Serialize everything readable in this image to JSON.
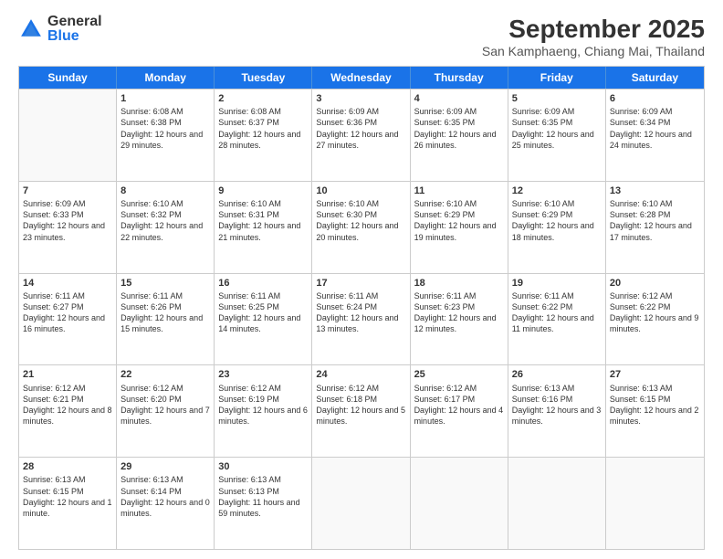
{
  "logo": {
    "general": "General",
    "blue": "Blue"
  },
  "calendar": {
    "title": "September 2025",
    "subtitle": "San Kamphaeng, Chiang Mai, Thailand",
    "headers": [
      "Sunday",
      "Monday",
      "Tuesday",
      "Wednesday",
      "Thursday",
      "Friday",
      "Saturday"
    ],
    "weeks": [
      [
        {
          "day": "",
          "empty": true
        },
        {
          "day": "1",
          "sunrise": "Sunrise: 6:08 AM",
          "sunset": "Sunset: 6:38 PM",
          "daylight": "Daylight: 12 hours and 29 minutes."
        },
        {
          "day": "2",
          "sunrise": "Sunrise: 6:08 AM",
          "sunset": "Sunset: 6:37 PM",
          "daylight": "Daylight: 12 hours and 28 minutes."
        },
        {
          "day": "3",
          "sunrise": "Sunrise: 6:09 AM",
          "sunset": "Sunset: 6:36 PM",
          "daylight": "Daylight: 12 hours and 27 minutes."
        },
        {
          "day": "4",
          "sunrise": "Sunrise: 6:09 AM",
          "sunset": "Sunset: 6:35 PM",
          "daylight": "Daylight: 12 hours and 26 minutes."
        },
        {
          "day": "5",
          "sunrise": "Sunrise: 6:09 AM",
          "sunset": "Sunset: 6:35 PM",
          "daylight": "Daylight: 12 hours and 25 minutes."
        },
        {
          "day": "6",
          "sunrise": "Sunrise: 6:09 AM",
          "sunset": "Sunset: 6:34 PM",
          "daylight": "Daylight: 12 hours and 24 minutes."
        }
      ],
      [
        {
          "day": "7",
          "sunrise": "Sunrise: 6:09 AM",
          "sunset": "Sunset: 6:33 PM",
          "daylight": "Daylight: 12 hours and 23 minutes."
        },
        {
          "day": "8",
          "sunrise": "Sunrise: 6:10 AM",
          "sunset": "Sunset: 6:32 PM",
          "daylight": "Daylight: 12 hours and 22 minutes."
        },
        {
          "day": "9",
          "sunrise": "Sunrise: 6:10 AM",
          "sunset": "Sunset: 6:31 PM",
          "daylight": "Daylight: 12 hours and 21 minutes."
        },
        {
          "day": "10",
          "sunrise": "Sunrise: 6:10 AM",
          "sunset": "Sunset: 6:30 PM",
          "daylight": "Daylight: 12 hours and 20 minutes."
        },
        {
          "day": "11",
          "sunrise": "Sunrise: 6:10 AM",
          "sunset": "Sunset: 6:29 PM",
          "daylight": "Daylight: 12 hours and 19 minutes."
        },
        {
          "day": "12",
          "sunrise": "Sunrise: 6:10 AM",
          "sunset": "Sunset: 6:29 PM",
          "daylight": "Daylight: 12 hours and 18 minutes."
        },
        {
          "day": "13",
          "sunrise": "Sunrise: 6:10 AM",
          "sunset": "Sunset: 6:28 PM",
          "daylight": "Daylight: 12 hours and 17 minutes."
        }
      ],
      [
        {
          "day": "14",
          "sunrise": "Sunrise: 6:11 AM",
          "sunset": "Sunset: 6:27 PM",
          "daylight": "Daylight: 12 hours and 16 minutes."
        },
        {
          "day": "15",
          "sunrise": "Sunrise: 6:11 AM",
          "sunset": "Sunset: 6:26 PM",
          "daylight": "Daylight: 12 hours and 15 minutes."
        },
        {
          "day": "16",
          "sunrise": "Sunrise: 6:11 AM",
          "sunset": "Sunset: 6:25 PM",
          "daylight": "Daylight: 12 hours and 14 minutes."
        },
        {
          "day": "17",
          "sunrise": "Sunrise: 6:11 AM",
          "sunset": "Sunset: 6:24 PM",
          "daylight": "Daylight: 12 hours and 13 minutes."
        },
        {
          "day": "18",
          "sunrise": "Sunrise: 6:11 AM",
          "sunset": "Sunset: 6:23 PM",
          "daylight": "Daylight: 12 hours and 12 minutes."
        },
        {
          "day": "19",
          "sunrise": "Sunrise: 6:11 AM",
          "sunset": "Sunset: 6:22 PM",
          "daylight": "Daylight: 12 hours and 11 minutes."
        },
        {
          "day": "20",
          "sunrise": "Sunrise: 6:12 AM",
          "sunset": "Sunset: 6:22 PM",
          "daylight": "Daylight: 12 hours and 9 minutes."
        }
      ],
      [
        {
          "day": "21",
          "sunrise": "Sunrise: 6:12 AM",
          "sunset": "Sunset: 6:21 PM",
          "daylight": "Daylight: 12 hours and 8 minutes."
        },
        {
          "day": "22",
          "sunrise": "Sunrise: 6:12 AM",
          "sunset": "Sunset: 6:20 PM",
          "daylight": "Daylight: 12 hours and 7 minutes."
        },
        {
          "day": "23",
          "sunrise": "Sunrise: 6:12 AM",
          "sunset": "Sunset: 6:19 PM",
          "daylight": "Daylight: 12 hours and 6 minutes."
        },
        {
          "day": "24",
          "sunrise": "Sunrise: 6:12 AM",
          "sunset": "Sunset: 6:18 PM",
          "daylight": "Daylight: 12 hours and 5 minutes."
        },
        {
          "day": "25",
          "sunrise": "Sunrise: 6:12 AM",
          "sunset": "Sunset: 6:17 PM",
          "daylight": "Daylight: 12 hours and 4 minutes."
        },
        {
          "day": "26",
          "sunrise": "Sunrise: 6:13 AM",
          "sunset": "Sunset: 6:16 PM",
          "daylight": "Daylight: 12 hours and 3 minutes."
        },
        {
          "day": "27",
          "sunrise": "Sunrise: 6:13 AM",
          "sunset": "Sunset: 6:15 PM",
          "daylight": "Daylight: 12 hours and 2 minutes."
        }
      ],
      [
        {
          "day": "28",
          "sunrise": "Sunrise: 6:13 AM",
          "sunset": "Sunset: 6:15 PM",
          "daylight": "Daylight: 12 hours and 1 minute."
        },
        {
          "day": "29",
          "sunrise": "Sunrise: 6:13 AM",
          "sunset": "Sunset: 6:14 PM",
          "daylight": "Daylight: 12 hours and 0 minutes."
        },
        {
          "day": "30",
          "sunrise": "Sunrise: 6:13 AM",
          "sunset": "Sunset: 6:13 PM",
          "daylight": "Daylight: 11 hours and 59 minutes."
        },
        {
          "day": "",
          "empty": true
        },
        {
          "day": "",
          "empty": true
        },
        {
          "day": "",
          "empty": true
        },
        {
          "day": "",
          "empty": true
        }
      ]
    ]
  }
}
